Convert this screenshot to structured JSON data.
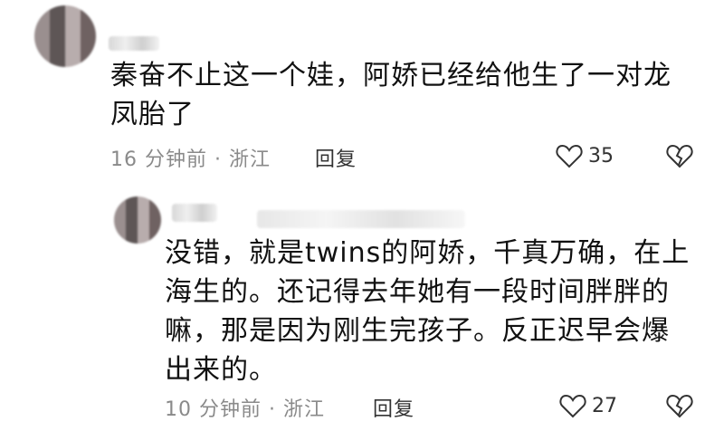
{
  "comments": [
    {
      "text": "秦奋不止这一个娃，阿娇已经给他生了一对龙凤胎了",
      "line1": "秦奋不止这一个娃，阿娇已经给他生了一对龙",
      "line2": "凤胎了",
      "time": "16 分钟前 · 浙江",
      "reply_label": "回复",
      "like_count": "35"
    },
    {
      "text": "没错，就是twins的阿娇，千真万确，在上海生的。还记得去年她有一段时间胖胖的嘛，那是因为刚生完孩子。反正迟早会爆出来的。",
      "line1": "没错，就是twins的阿娇，千真万确，在上",
      "line2": "海生的。还记得去年她有一段时间胖胖的",
      "line3": "嘛，那是因为刚生完孩子。反正迟早会爆",
      "line4": "出来的。",
      "time": "10 分钟前 · 浙江",
      "reply_label": "回复",
      "like_count": "27"
    }
  ],
  "icons": [
    "heart-icon",
    "broken-heart-icon"
  ]
}
